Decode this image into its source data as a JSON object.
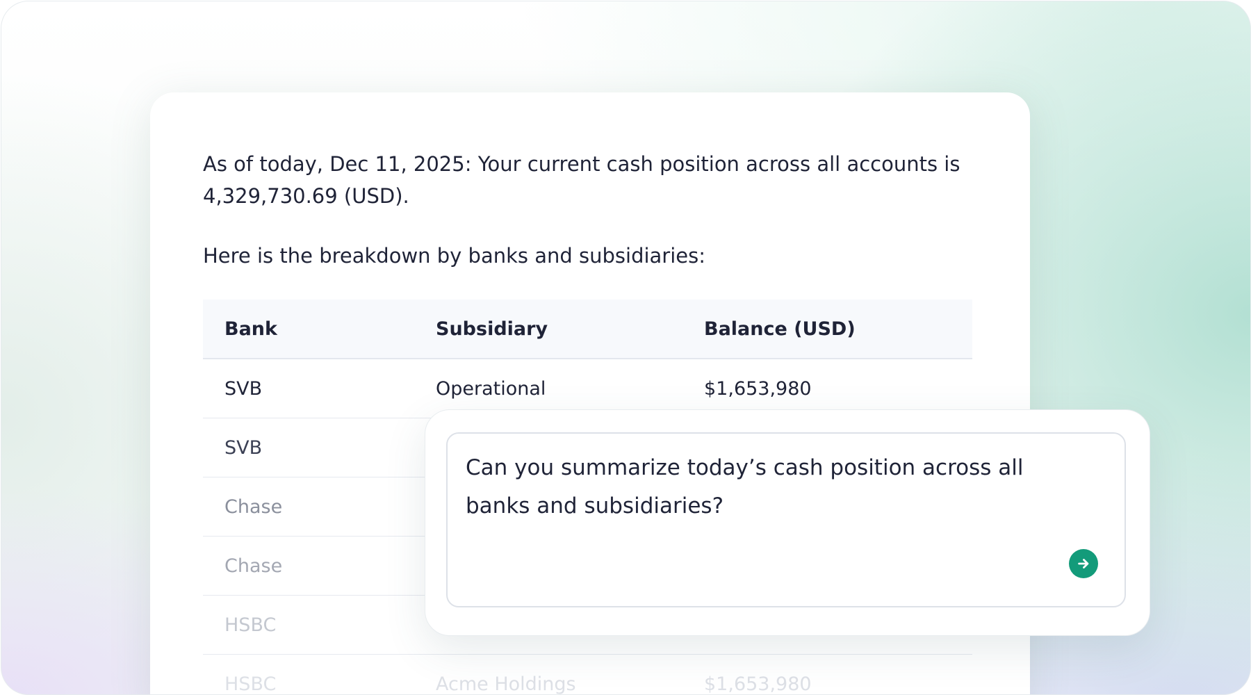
{
  "response": {
    "intro": "As of today, Dec 11, 2025: Your current cash position across all accounts is 4,329,730.69 (USD).",
    "breakdown": "Here is the breakdown by banks and subsidiaries:"
  },
  "table": {
    "headers": [
      "Bank",
      "Subsidiary",
      "Balance (USD)"
    ],
    "rows": [
      {
        "bank": "SVB",
        "subsidiary": "Operational",
        "balance": "$1,653,980"
      },
      {
        "bank": "SVB",
        "subsidiary": "",
        "balance": ""
      },
      {
        "bank": "Chase",
        "subsidiary": "",
        "balance": ""
      },
      {
        "bank": "Chase",
        "subsidiary": "",
        "balance": ""
      },
      {
        "bank": "HSBC",
        "subsidiary": "",
        "balance": ""
      },
      {
        "bank": "HSBC",
        "subsidiary": "Acme Holdings",
        "balance": "$1,653,980"
      }
    ]
  },
  "chat": {
    "prompt": "Can you summarize today’s cash position across all banks and subsidiaries?",
    "send_icon": "arrow-right-icon",
    "accent_color": "#139b7a"
  }
}
